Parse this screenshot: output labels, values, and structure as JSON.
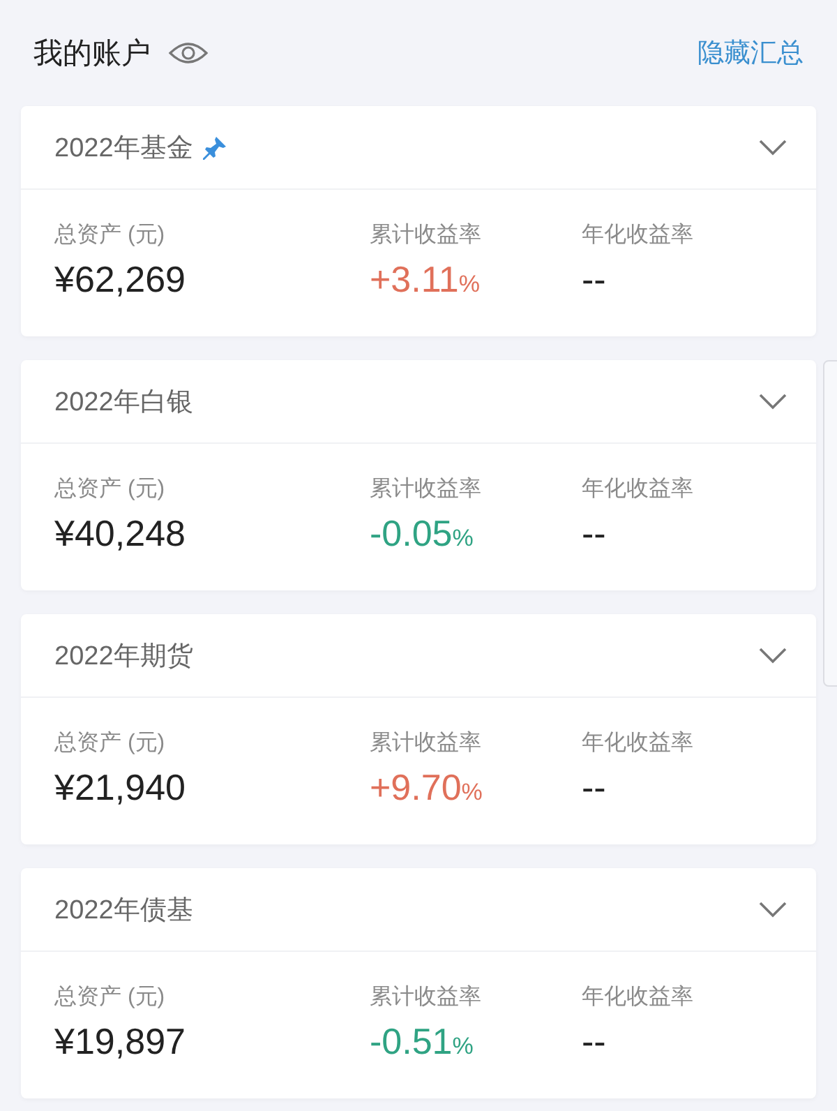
{
  "header": {
    "title": "我的账户",
    "action": "隐藏汇总"
  },
  "accounts": [
    {
      "name": "2022年基金",
      "pinned": true,
      "asset_label": "总资产 (元)",
      "asset": "¥62,269",
      "return_label": "累计收益率",
      "return_value": "+3.11",
      "return_unit": "%",
      "color": "#e0705a",
      "annual_label": "年化收益率",
      "annual": "--"
    },
    {
      "name": "2022年白银",
      "pinned": false,
      "asset_label": "总资产 (元)",
      "asset": "¥40,248",
      "return_label": "累计收益率",
      "return_value": "-0.05",
      "return_unit": "%",
      "color": "#2fa383",
      "annual_label": "年化收益率",
      "annual": "--"
    },
    {
      "name": "2022年期货",
      "pinned": false,
      "asset_label": "总资产 (元)",
      "asset": "¥21,940",
      "return_label": "累计收益率",
      "return_value": "+9.70",
      "return_unit": "%",
      "color": "#e0705a",
      "annual_label": "年化收益率",
      "annual": "--"
    },
    {
      "name": "2022年债基",
      "pinned": false,
      "asset_label": "总资产 (元)",
      "asset": "¥19,897",
      "return_label": "累计收益率",
      "return_value": "-0.51",
      "return_unit": "%",
      "color": "#2fa383",
      "annual_label": "年化收益率",
      "annual": "--"
    }
  ]
}
